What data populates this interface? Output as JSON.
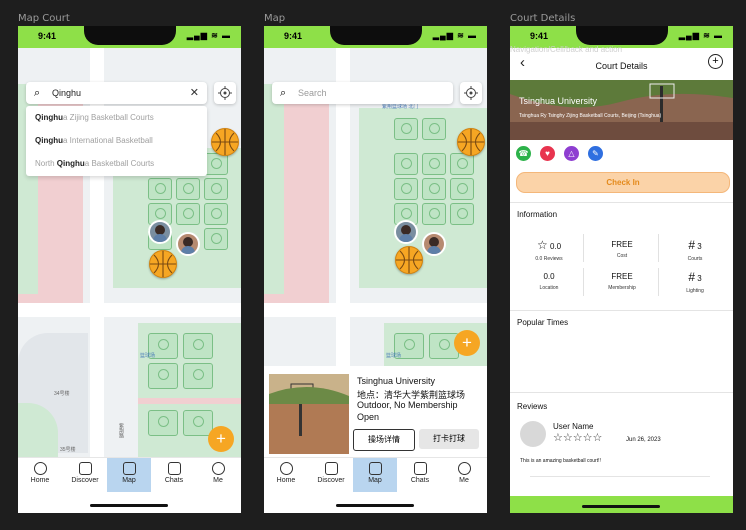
{
  "frames": {
    "map_court": "Map Court",
    "map": "Map",
    "court_details": "Court Details"
  },
  "status": {
    "time": "9:41",
    "icons": "▂▄▆ ≋ ▬"
  },
  "search": {
    "query": "Qinghu",
    "placeholder": "Search",
    "suggestions": [
      {
        "bold": "Qinghu",
        "rest": "a Zijing Basketball Courts",
        "prefix": ""
      },
      {
        "bold": "Qinghu",
        "rest": "a International Basketball",
        "prefix": ""
      },
      {
        "bold": "Qinghu",
        "rest": "a Basketball Courts",
        "prefix": "North "
      }
    ]
  },
  "map_labels": {
    "building_top": "紫荆篮球场 北门",
    "court_label": "篮球场",
    "bldg_34": "34号楼",
    "bldg_35": "35号楼",
    "road": "紫荆路"
  },
  "tabs": [
    {
      "label": "Home",
      "icon": "home-icon"
    },
    {
      "label": "Discover",
      "icon": "compass-icon"
    },
    {
      "label": "Map",
      "icon": "map-icon"
    },
    {
      "label": "Chats",
      "icon": "chat-icon"
    },
    {
      "label": "Me",
      "icon": "user-icon"
    }
  ],
  "fab": "+",
  "court_card": {
    "name": "Tsinghua University",
    "location": "地点：清华大学紫荆篮球场",
    "tags": "Outdoor, No Membership",
    "status": "Open",
    "details_button": "操场详情",
    "checkin_button": "打卡打球"
  },
  "details": {
    "nav_hint": "Navigation/Cell/back and action",
    "title": "Court Details",
    "back": "‹",
    "add": "+",
    "hero_title": "Tsinghua University",
    "hero_address": "Tsinghua Ry Tsinghy Zijing Basketball Courts, Beijing (Tsinghua)",
    "action_icons": [
      "☎",
      "♥",
      "△",
      "✎"
    ],
    "action_colors": [
      "#2db24a",
      "#e8344f",
      "#8e3ed1",
      "#2f6fe0"
    ],
    "check_in": "Check In",
    "information": "Information",
    "stats": [
      {
        "icon": "☆",
        "value": "0.0",
        "label": "0.0 Reviews"
      },
      {
        "icon": "",
        "value": "FREE",
        "label": "Cost"
      },
      {
        "icon": "#",
        "value": "3",
        "label": "Courts"
      },
      {
        "icon": "",
        "value": "0.0",
        "label": "Location"
      },
      {
        "icon": "",
        "value": "FREE",
        "label": "Membership"
      },
      {
        "icon": "#",
        "value": "3",
        "label": "Lighting"
      }
    ],
    "popular_times": "Popular Times",
    "reviews": "Reviews",
    "review": {
      "user": "User Name",
      "stars": "☆☆☆☆☆",
      "date": "Jun 26, 2023",
      "text": "This is an amazing basketball court!!"
    }
  }
}
